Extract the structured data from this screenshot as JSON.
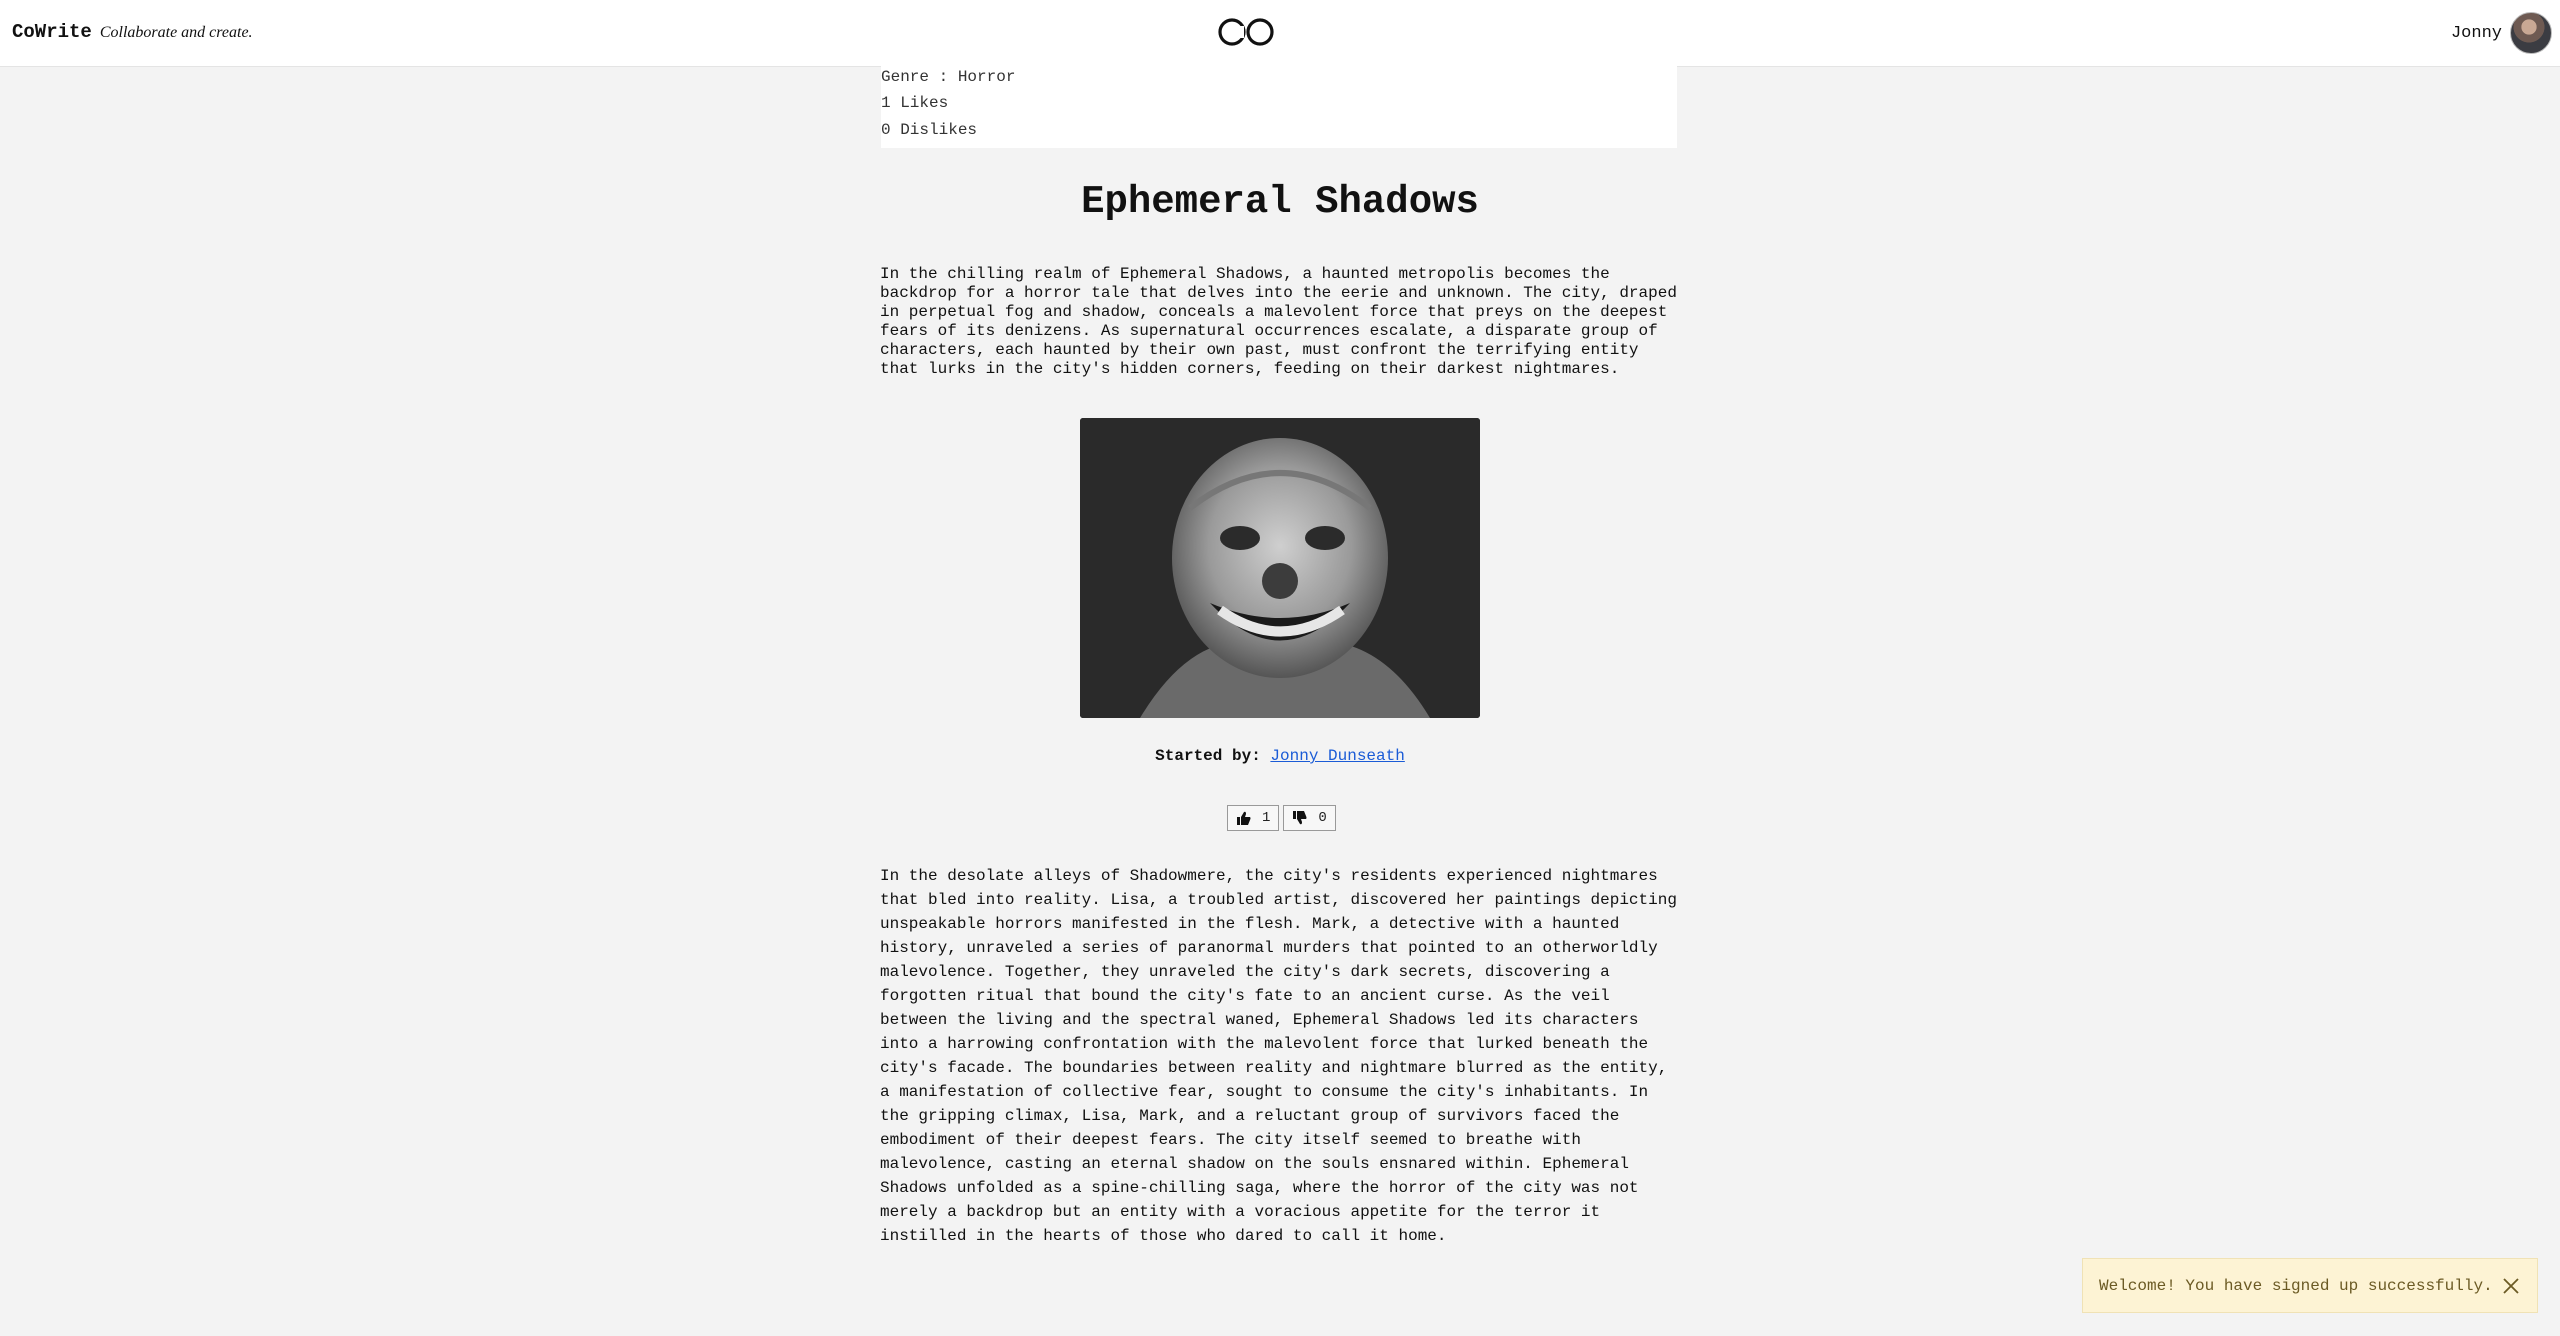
{
  "header": {
    "brand_name": "CoWrite",
    "brand_tagline": "Collaborate and create.",
    "logo_text": "CO",
    "user_name": "Jonny",
    "avatar_icon": "avatar"
  },
  "info": {
    "genre": "Genre : Horror",
    "likes": "1 Likes",
    "dislikes": "0 Dislikes"
  },
  "story": {
    "title": "Ephemeral Shadows",
    "synopsis": "In the chilling realm of Ephemeral Shadows, a haunted metropolis becomes the backdrop for a horror tale that delves into the eerie and unknown. The city, draped in perpetual fog and shadow, conceals a malevolent force that preys on the deepest fears of its denizens. As supernatural occurrences escalate, a disparate group of characters, each haunted by their own past, must confront the terrifying entity that lurks in the city's hidden corners, feeding on their darkest nightmares.",
    "started_by_label": "Started by:",
    "author": "Jonny Dunseath",
    "like_count": "1",
    "dislike_count": "0",
    "body": "In the desolate alleys of Shadowmere, the city's residents experienced nightmares that bled into reality. Lisa, a troubled artist, discovered her paintings depicting unspeakable horrors manifested in the flesh. Mark, a detective with a haunted history, unraveled a series of paranormal murders that pointed to an otherworldly malevolence. Together, they unraveled the city's dark secrets, discovering a forgotten ritual that bound the city's fate to an ancient curse. As the veil between the living and the spectral waned, Ephemeral Shadows led its characters into a harrowing confrontation with the malevolent force that lurked beneath the city's facade. The boundaries between reality and nightmare blurred as the entity, a manifestation of collective fear, sought to consume the city's inhabitants. In the gripping climax, Lisa, Mark, and a reluctant group of survivors faced the embodiment of their deepest fears. The city itself seemed to breathe with malevolence, casting an eternal shadow on the souls ensnared within. Ephemeral Shadows unfolded as a spine-chilling saga, where the horror of the city was not merely a backdrop but an entity with a voracious appetite for the terror it instilled in the hearts of those who dared to call it home."
  },
  "toast": {
    "message": "Welcome! You have signed up successfully.",
    "close_icon": "close-icon"
  }
}
